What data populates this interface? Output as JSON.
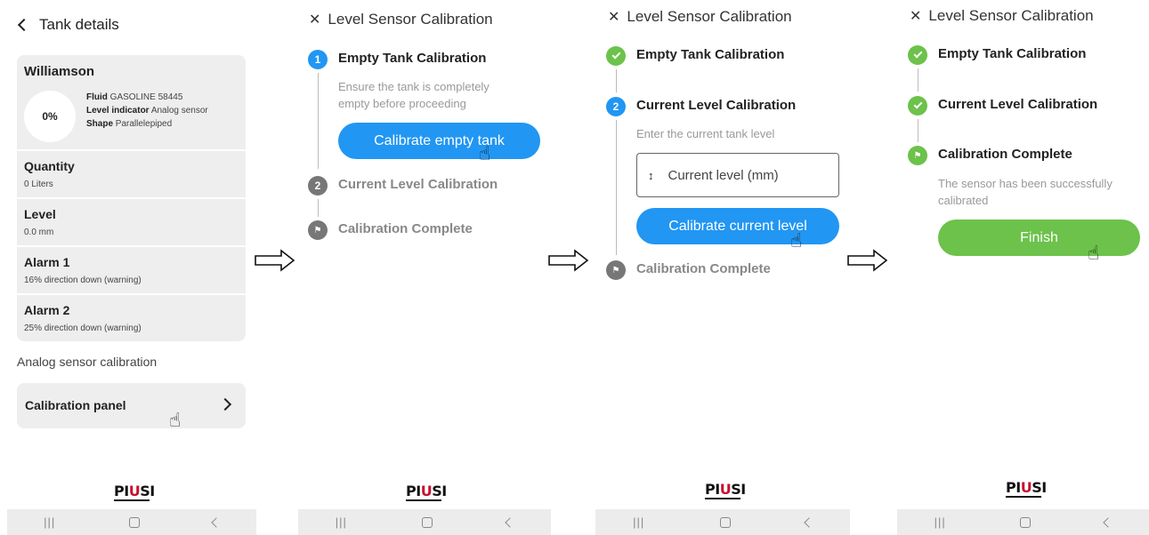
{
  "screen1": {
    "back_label": "Tank details",
    "tank": {
      "name": "Williamson",
      "gauge_percent": "0%",
      "fluid_label": "Fluid",
      "fluid_value": "GASOLINE 58445",
      "level_indicator_label": "Level indicator",
      "level_indicator_value": "Analog sensor",
      "shape_label": "Shape",
      "shape_value": "Parallelepiped"
    },
    "rows": [
      {
        "title": "Quantity",
        "sub": "0 Liters"
      },
      {
        "title": "Level",
        "sub": "0.0 mm"
      },
      {
        "title": "Alarm 1",
        "sub": "16% direction down (warning)"
      },
      {
        "title": "Alarm 2",
        "sub": "25% direction down (warning)"
      }
    ],
    "section_label": "Analog sensor calibration",
    "panel_button": "Calibration panel"
  },
  "screen2": {
    "title": "Level Sensor Calibration",
    "step1_number": "1",
    "step1_label": "Empty Tank Calibration",
    "step1_desc_line1": "Ensure the tank is completely",
    "step1_desc_line2": "empty before proceeding",
    "step1_button": "Calibrate empty tank",
    "step2_number": "2",
    "step2_label": "Current Level Calibration",
    "step3_label": "Calibration Complete"
  },
  "screen3": {
    "title": "Level Sensor Calibration",
    "step1_label": "Empty Tank Calibration",
    "step2_number": "2",
    "step2_label": "Current Level Calibration",
    "step2_desc": "Enter the current tank level",
    "input_placeholder": "Current level (mm)",
    "step2_button": "Calibrate current level",
    "step3_label": "Calibration Complete"
  },
  "screen4": {
    "title": "Level Sensor Calibration",
    "step1_label": "Empty Tank Calibration",
    "step2_label": "Current Level Calibration",
    "step3_label": "Calibration Complete",
    "step3_desc_line1": "The sensor has been successfully",
    "step3_desc_line2": "calibrated",
    "finish_button": "Finish"
  },
  "footer": {
    "logo_text_pre": "PI",
    "logo_text_u": "U",
    "logo_text_post": "SI"
  },
  "colors": {
    "accent_blue": "#2196f3",
    "success_green": "#6cc24a",
    "card_gray": "#eeeeee",
    "logo_red": "#c8102e"
  },
  "icons": {
    "back": "chevron-left-icon",
    "close": "close-icon",
    "check": "check-icon",
    "flag": "flag-icon",
    "arrow": "right-arrow-icon",
    "hand": "hand-pointer-icon",
    "updown": "up-down-icon"
  }
}
